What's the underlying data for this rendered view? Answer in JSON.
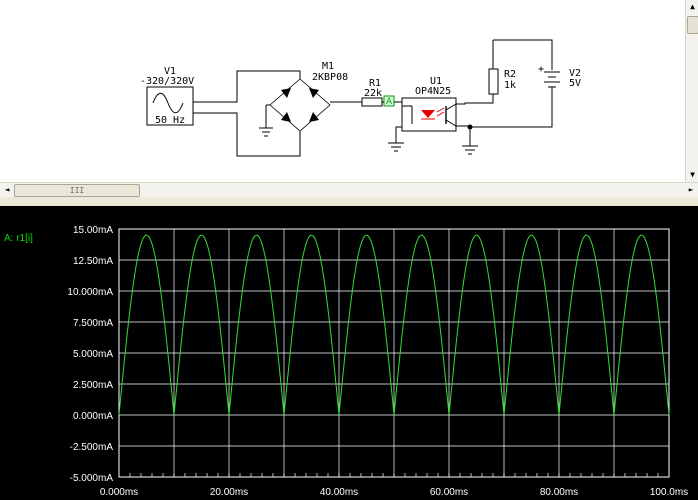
{
  "schematic": {
    "v1": {
      "ref": "V1",
      "value": "-320/320V",
      "freq": "50 Hz"
    },
    "m1": {
      "ref": "M1",
      "part": "2KBP08"
    },
    "r1": {
      "ref": "R1",
      "value": "22k",
      "probe": "A"
    },
    "u1": {
      "ref": "U1",
      "part": "OP4N25"
    },
    "r2": {
      "ref": "R2",
      "value": "1k"
    },
    "v2": {
      "ref": "V2",
      "value": "5V",
      "plus": "+",
      "minus": "-"
    }
  },
  "scrollbars": {
    "thumb_grip": "III",
    "up": "▲",
    "down": "▼",
    "left": "◄",
    "right": "►"
  },
  "grapher": {
    "trace_label": "A: r1[i]",
    "trace_color": "#33dd33",
    "background": "#000000",
    "grid_color": "#ffffff"
  },
  "chart_data": {
    "type": "line",
    "xlabel": "",
    "ylabel": "",
    "xlim": [
      0,
      100
    ],
    "ylim": [
      -5,
      15
    ],
    "x_ticks": [
      "0.000ms",
      "20.00ms",
      "40.00ms",
      "60.00ms",
      "80.00ms",
      "100.0ms"
    ],
    "x_tick_values": [
      0,
      20,
      40,
      60,
      80,
      100
    ],
    "y_ticks": [
      "15.00mA",
      "12.50mA",
      "10.000mA",
      "7.500mA",
      "5.000mA",
      "2.500mA",
      "0.000mA",
      "-2.500mA",
      "-5.000mA"
    ],
    "y_tick_values": [
      15,
      12.5,
      10,
      7.5,
      5,
      2.5,
      0,
      -2.5,
      -5
    ],
    "grid": true,
    "series": [
      {
        "name": "A: r1[i]",
        "waveform": "full-wave rectified sine",
        "frequency_hz": 50,
        "period_ms": 20,
        "peak_ma": 14.5,
        "min_ma": 0,
        "x_start_ms": 0,
        "x_end_ms": 100
      }
    ]
  }
}
